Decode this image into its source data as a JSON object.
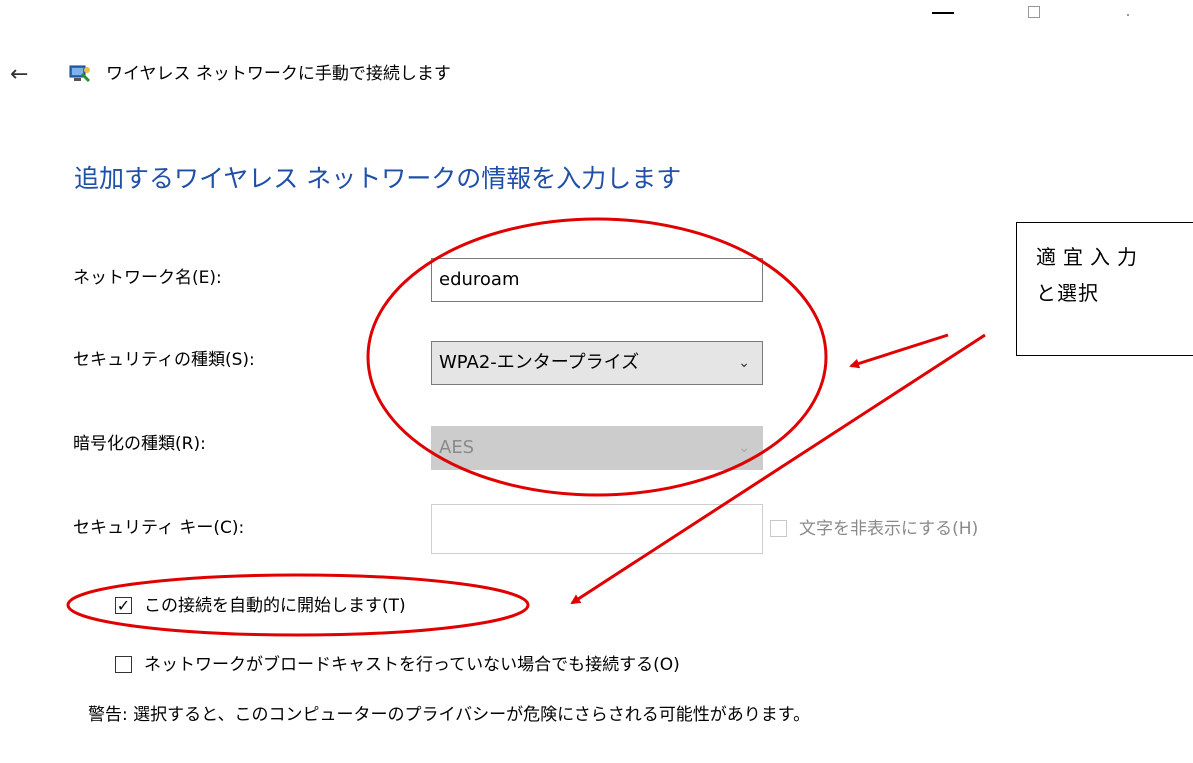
{
  "window": {
    "controls": [
      "minimize-icon",
      "maximize-icon",
      "close-icon"
    ]
  },
  "header": {
    "back_icon": "back-arrow-icon",
    "network_icon": "wireless-network-icon",
    "title": "ワイヤレス ネットワークに手動で接続します"
  },
  "main": {
    "heading": "追加するワイヤレス ネットワークの情報を入力します",
    "network_name": {
      "label": "ネットワーク名(E):",
      "value": "eduroam"
    },
    "security_type": {
      "label": "セキュリティの種類(S):",
      "value": "WPA2-エンタープライズ"
    },
    "encryption_type": {
      "label": "暗号化の種類(R):",
      "value": "AES",
      "disabled": true
    },
    "security_key": {
      "label": "セキュリティ キー(C):",
      "value": "",
      "hide_chars_label": "文字を非表示にする(H)",
      "hide_chars_checked": false
    },
    "auto_start": {
      "label": "この接続を自動的に開始します(T)",
      "checked": true
    },
    "connect_hidden": {
      "label": "ネットワークがブロードキャストを行っていない場合でも接続する(O)",
      "checked": false
    },
    "warning": "警告: 選択すると、このコンピューターのプライバシーが危険にさらされる可能性があります。"
  },
  "annotation": {
    "note_line1": "適宜入力",
    "note_line2": "と選択",
    "color": "#e00000"
  }
}
